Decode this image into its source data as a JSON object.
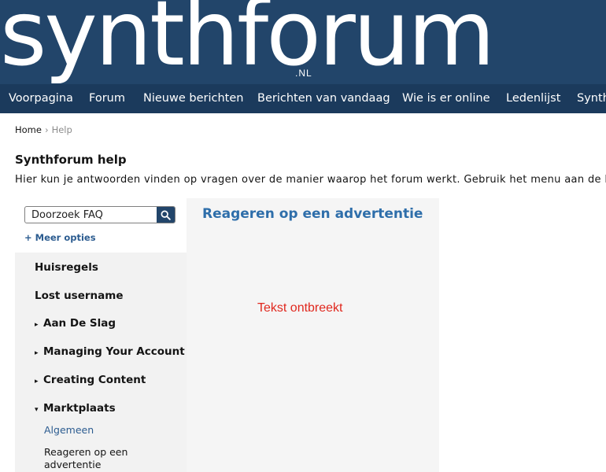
{
  "header": {
    "logo_text": "synthforum",
    "logo_tld": ".NL"
  },
  "nav": {
    "items": [
      "Voorpagina",
      "Forum",
      "Nieuwe berichten",
      "Berichten van vandaag",
      "Wie is er online",
      "Ledenlijst",
      "Synth"
    ]
  },
  "breadcrumb": {
    "home": "Home",
    "separator": "›",
    "current": "Help"
  },
  "page": {
    "title": "Synthforum help",
    "intro": "Hier kun je antwoorden vinden op vragen over de manier waarop het forum werkt. Gebruik het menu aan de linker"
  },
  "search": {
    "placeholder": "Doorzoek FAQ",
    "icon": "search-icon"
  },
  "more_options": "+ Meer opties",
  "sidebar": {
    "items": [
      {
        "label": "Huisregels",
        "arrow": ""
      },
      {
        "label": "Lost username",
        "arrow": ""
      },
      {
        "label": "Aan De Slag",
        "arrow": "▸"
      },
      {
        "label": "Managing Your Account",
        "arrow": "▸"
      },
      {
        "label": "Creating Content",
        "arrow": "▸"
      },
      {
        "label": "Marktplaats",
        "arrow": "▾"
      }
    ],
    "subitems": [
      {
        "label": "Algemeen",
        "color": "#2c5c90"
      },
      {
        "label": "Reageren op een",
        "color": "#141414"
      },
      {
        "label": "advertentie",
        "color": "#141414"
      }
    ]
  },
  "content": {
    "title": "Reageren op een advertentie",
    "missing_text": "Tekst ontbreekt"
  },
  "colors": {
    "header_bg": "#22456a",
    "nav_bg": "#1b3a5c",
    "link": "#2c5c90",
    "content_title": "#2e6eaa",
    "error": "#e0281e"
  }
}
